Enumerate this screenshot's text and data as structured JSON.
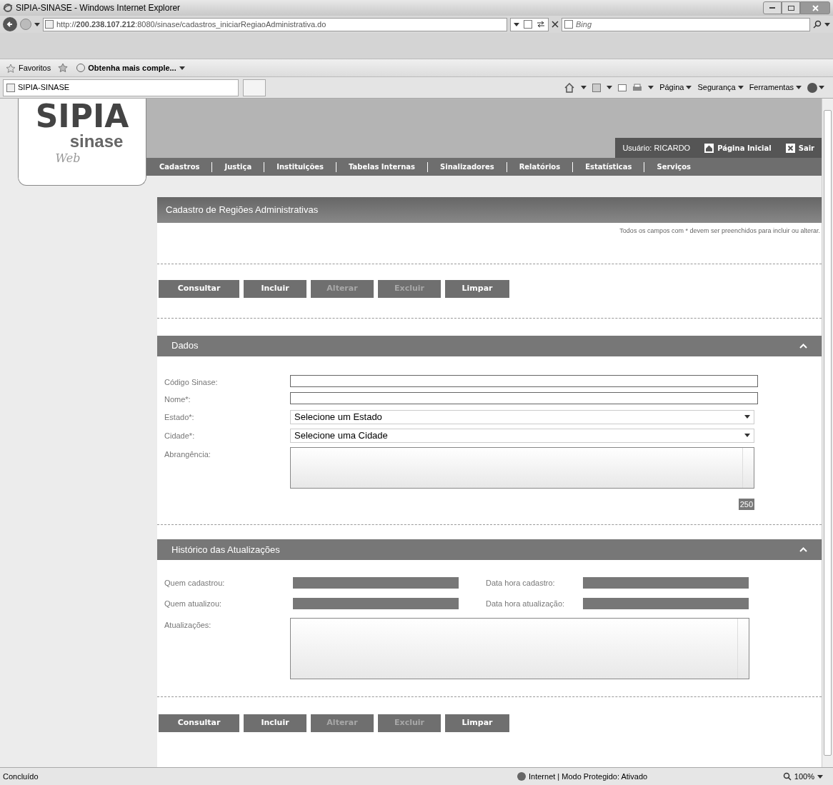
{
  "browser": {
    "title": "SIPIA-SINASE - Windows Internet Explorer",
    "address": "http://**200.238.107.212**:8080/sinase/cadastros_iniciarRegiaoAdministrativa.do",
    "search_placeholder": "Bing",
    "favorites": "Favoritos",
    "favorite_link": "Obtenha mais comple...",
    "tab": "SIPIA-SINASE",
    "commands": [
      "Página",
      "Segurança",
      "Ferramentas"
    ]
  },
  "app": {
    "logo": {
      "title": "SIPIA",
      "subtitle": "sinase",
      "tag": "Web"
    },
    "user": "Usuário: RICARDO",
    "links": [
      {
        "kind": "home",
        "label": "Página Inicial"
      },
      {
        "kind": "exit",
        "label": "Sair"
      }
    ],
    "nav": [
      "Cadastros",
      "Justiça",
      "Instituições",
      "Tabelas Internas",
      "Sinalizadores",
      "Relatórios",
      "Estatísticas",
      "Serviços"
    ]
  },
  "page": {
    "title": "Cadastro de Regiões Administrativas",
    "note": "Todos os campos com * devem ser preenchidos para incluir ou alterar.",
    "buttons_top": [
      {
        "label": "Consultar",
        "disabled": false
      },
      {
        "label": "Incluir",
        "disabled": false
      },
      {
        "label": "Alterar",
        "disabled": true
      },
      {
        "label": "Excluir",
        "disabled": true
      },
      {
        "label": "Limpar",
        "disabled": false
      }
    ],
    "dados": {
      "title": "Dados",
      "expanded": true,
      "fields": [
        {
          "label": "Código Sinase:",
          "kind": "text"
        },
        {
          "label": "Nome*:",
          "kind": "text"
        },
        {
          "label": "Estado*:",
          "kind": "select",
          "value": "Selecione um Estado"
        },
        {
          "label": "Cidade*:",
          "kind": "select",
          "value": "Selecione uma Cidade"
        },
        {
          "label": "Abrangência:",
          "kind": "textarea",
          "counter": "250"
        }
      ]
    },
    "historico": {
      "title": "Histórico das Atualizações",
      "expanded": true,
      "rows": [
        {
          "cells": [
            "Quem cadastrou:",
            "Data hora cadastro:"
          ]
        },
        {
          "cells": [
            "Quem atualizou:",
            "Data hora atualização:"
          ]
        }
      ],
      "textarea_label": "Atualizações:"
    },
    "buttons_bottom": [
      {
        "label": "Consultar",
        "disabled": false
      },
      {
        "label": "Incluir",
        "disabled": false
      },
      {
        "label": "Alterar",
        "disabled": true
      },
      {
        "label": "Excluir",
        "disabled": true
      },
      {
        "label": "Limpar",
        "disabled": false
      }
    ]
  },
  "status_bar": {
    "text": "Concluído",
    "zone": "Internet | Modo Protegido: Ativado",
    "zoom": "100%"
  }
}
